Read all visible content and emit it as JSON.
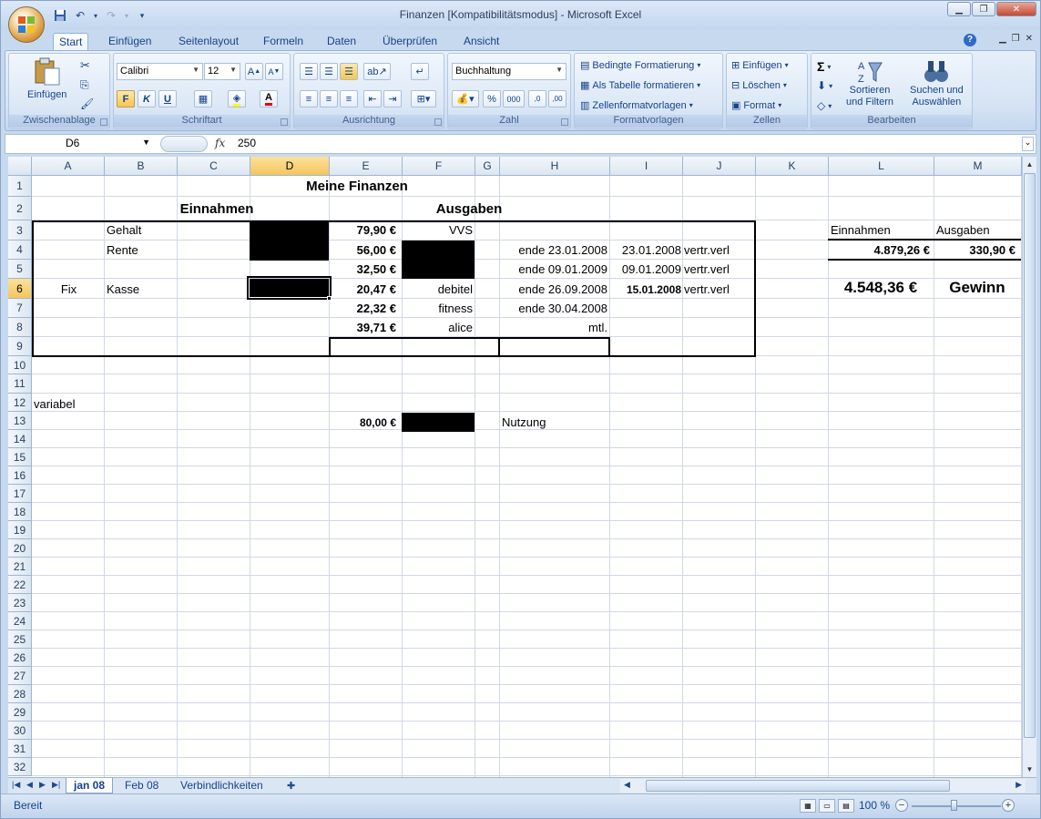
{
  "window": {
    "title": "Finanzen  [Kompatibilitätsmodus] - Microsoft Excel",
    "minimize": "▁",
    "restore": "❐",
    "close": "✕"
  },
  "ribbon_tabs": [
    "Start",
    "Einfügen",
    "Seitenlayout",
    "Formeln",
    "Daten",
    "Überprüfen",
    "Ansicht"
  ],
  "ribbon": {
    "clipboard": {
      "label": "Zwischenablage",
      "paste": "Einfügen"
    },
    "font": {
      "label": "Schriftart",
      "name": "Calibri",
      "size": "12",
      "bold": "F",
      "italic": "K",
      "underline": "U"
    },
    "alignment": {
      "label": "Ausrichtung"
    },
    "number": {
      "label": "Zahl",
      "format": "Buchhaltung",
      "percent": "%",
      "thousands": "000"
    },
    "styles": {
      "label": "Formatvorlagen",
      "conditional": "Bedingte Formatierung",
      "as_table": "Als Tabelle formatieren",
      "cell_styles": "Zellenformatvorlagen"
    },
    "cells": {
      "label": "Zellen",
      "insert": "Einfügen",
      "delete": "Löschen",
      "format": "Format"
    },
    "editing": {
      "label": "Bearbeiten",
      "sort_1": "Sortieren",
      "sort_2": "und Filtern",
      "find_1": "Suchen und",
      "find_2": "Auswählen"
    }
  },
  "formula_bar": {
    "name_box": "D6",
    "fx": "fx",
    "value": "250"
  },
  "columns": [
    "A",
    "B",
    "C",
    "D",
    "E",
    "F",
    "G",
    "H",
    "I",
    "J",
    "K",
    "L",
    "M"
  ],
  "rows": [
    "1",
    "2",
    "3",
    "4",
    "5",
    "6",
    "7",
    "8",
    "9",
    "10",
    "11",
    "12",
    "13",
    "14",
    "15",
    "16",
    "17",
    "18",
    "19",
    "20",
    "21",
    "22",
    "23",
    "24",
    "25",
    "26",
    "27",
    "28",
    "29",
    "30",
    "31",
    "32"
  ],
  "cells": {
    "title": "Meine Finanzen",
    "einnahmen_header": "Einnahmen",
    "ausgaben_header": "Ausgaben",
    "b3": "Gehalt",
    "b4": "Rente",
    "b6": "Kasse",
    "a6": "Fix",
    "a12": "variabel",
    "e3": "79,90 €",
    "e4": "56,00 €",
    "e5": "32,50 €",
    "e6": "20,47 €",
    "e7": "22,32 €",
    "e8": "39,71 €",
    "e13": "80,00 €",
    "f3": "VVS",
    "f6": "debitel",
    "f7": "fitness",
    "f8": "alice",
    "h4": "ende 23.01.2008",
    "h5": "ende 09.01.2009",
    "h6": "ende 26.09.2008",
    "h7": "ende 30.04.2008",
    "h8": "mtl.",
    "h13": "Nutzung",
    "i4": "23.01.2008",
    "i5": "09.01.2009",
    "i6": "15.01.2008",
    "j4": "vertr.verl",
    "j5": "vertr.verl",
    "j6": "vertr.verl",
    "l3": "Einnahmen",
    "m3": "Ausgaben",
    "l4": "4.879,26 €",
    "m4": "330,90 €",
    "l6": "4.548,36 €",
    "m6": "Gewinn"
  },
  "sheet_tabs": [
    "jan 08",
    "Feb 08",
    "Verbindlichkeiten"
  ],
  "status": {
    "ready": "Bereit",
    "zoom": "100 %"
  }
}
